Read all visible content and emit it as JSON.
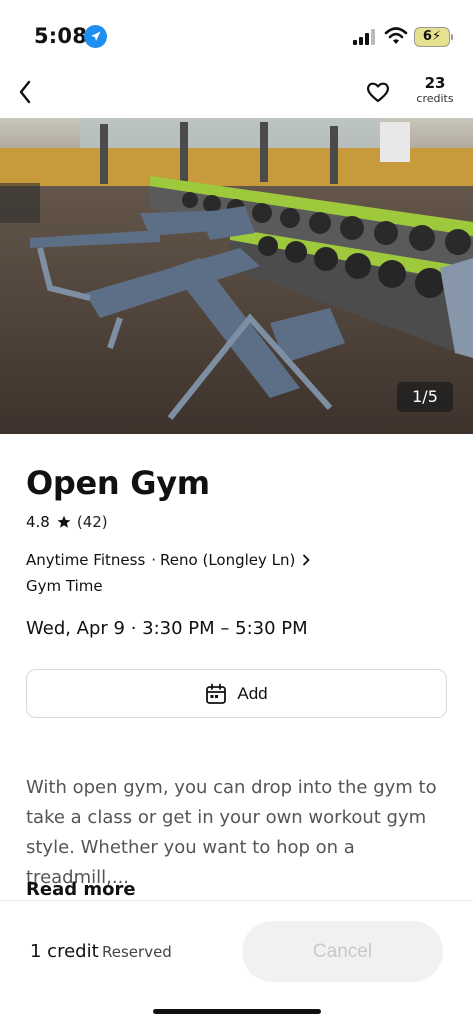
{
  "status_bar": {
    "time": "5:08",
    "battery": "6"
  },
  "header": {
    "credits_count": "23",
    "credits_label": "credits"
  },
  "gallery": {
    "counter": "1/5"
  },
  "class": {
    "title": "Open Gym",
    "rating": "4.8",
    "review_count": "(42)",
    "studio": "Anytime Fitness",
    "location": "Reno (Longley Ln)",
    "category": "Gym Time",
    "datetime": "Wed, Apr 9 · 3:30 PM – 5:30 PM"
  },
  "actions": {
    "add_label": "Add"
  },
  "description": {
    "text": "With open gym, you can drop into the gym to take a class or get in your own workout gym style. Whether you want to hop on a treadmill,...",
    "read_more": "Read more"
  },
  "footer": {
    "credit_cost": "1 credit",
    "reserved": "Reserved",
    "cancel_label": "Cancel"
  },
  "colors": {
    "accent_blue": "#1f8ef1",
    "battery_fill": "#e6e18e"
  }
}
